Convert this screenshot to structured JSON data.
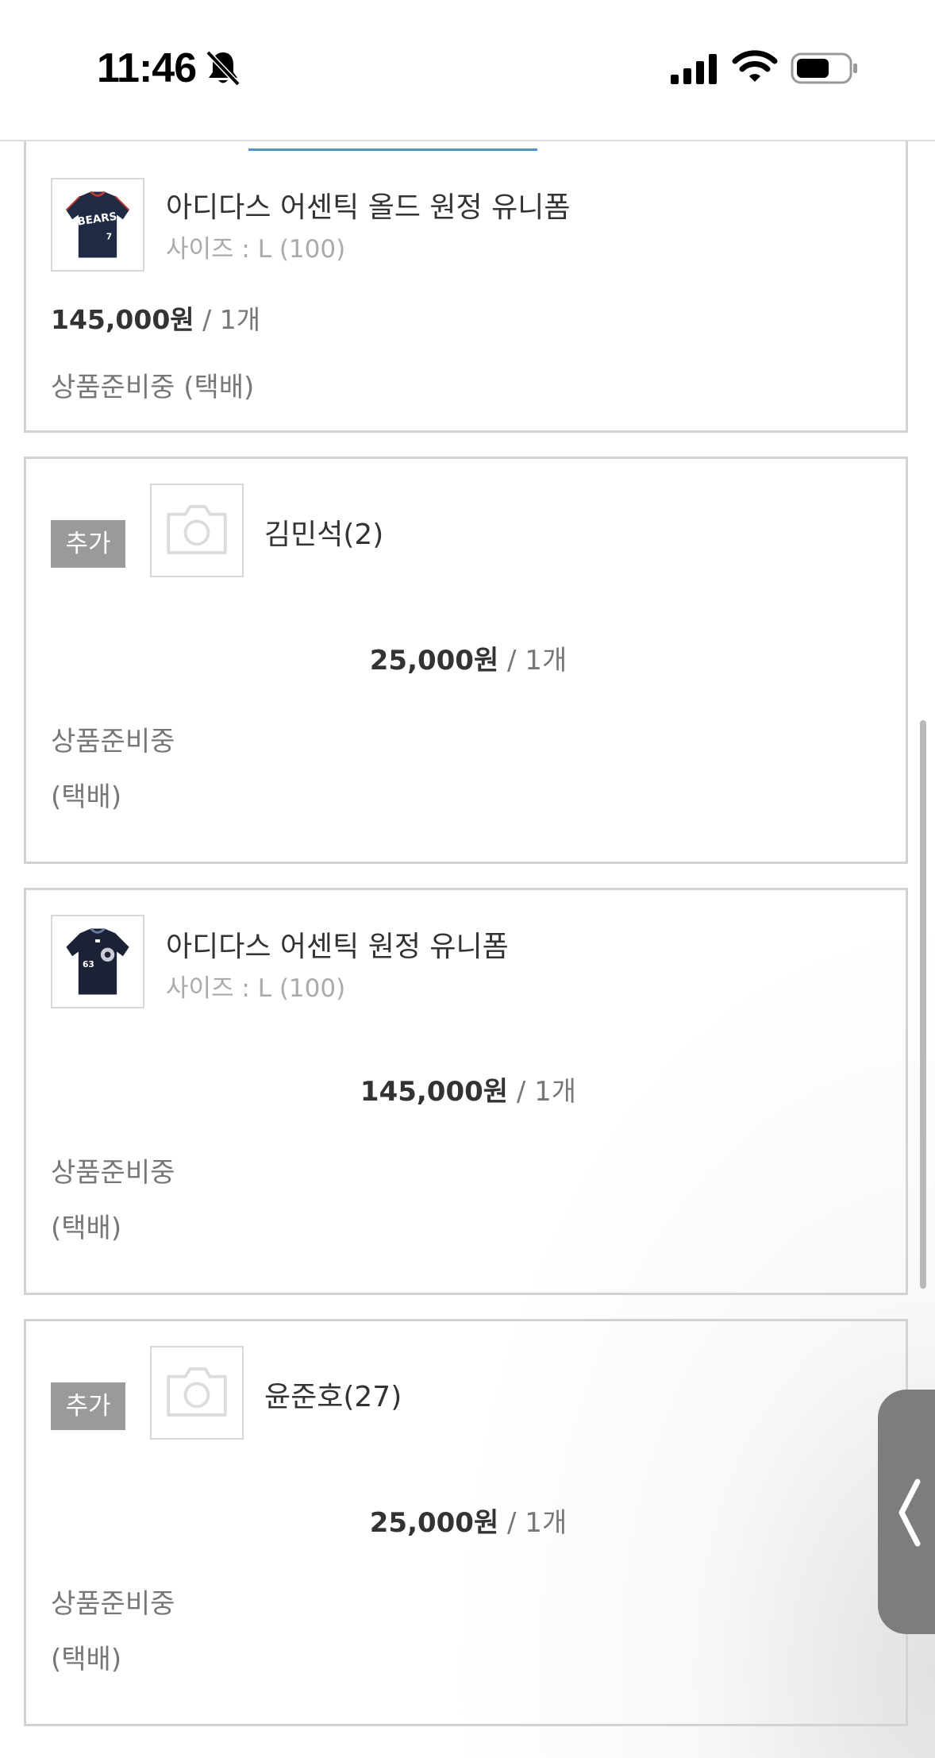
{
  "status_bar": {
    "time": "11:46"
  },
  "items": [
    {
      "type": "product",
      "name": "아디다스 어센틱 올드 원정 유니폼",
      "size": "사이즈 : L (100)",
      "price": "145,000원",
      "qty": "/ 1개",
      "status": "상품준비중 (택배)",
      "image_icon": "jersey-bears-7"
    },
    {
      "type": "option",
      "badge": "추가",
      "name": "김민석(2)",
      "price": "25,000원",
      "qty": "/ 1개",
      "status_line1": "상품준비중",
      "status_line2": "(택배)",
      "image_icon": "camera-placeholder-icon"
    },
    {
      "type": "product",
      "name": "아디다스 어센틱 원정 유니폼",
      "size": "사이즈 : L (100)",
      "price": "145,000원",
      "qty": "/ 1개",
      "status_line1": "상품준비중",
      "status_line2": "(택배)",
      "image_icon": "jersey-63"
    },
    {
      "type": "option",
      "badge": "추가",
      "name": "윤준호(27)",
      "price": "25,000원",
      "qty": "/ 1개",
      "status_line1": "상품준비중",
      "status_line2": "(택배)",
      "image_icon": "camera-placeholder-icon"
    }
  ],
  "colors": {
    "accent": "#4a8fe0",
    "badge_bg": "#9a9a9a",
    "border": "#d2d2d2"
  }
}
